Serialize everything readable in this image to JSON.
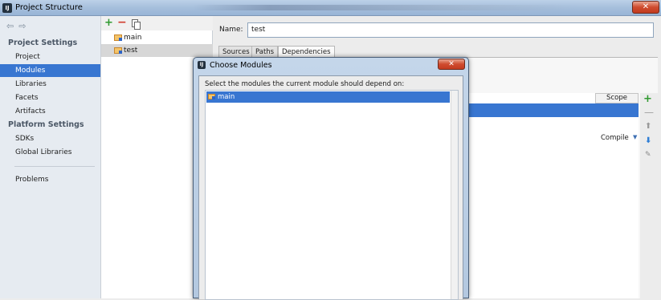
{
  "window": {
    "title": "Project Structure",
    "close_glyph": "✕"
  },
  "sidebar": {
    "nav_back": "⇦",
    "nav_forward": "⇨",
    "project_settings_header": "Project Settings",
    "project_items": [
      "Project",
      "Modules",
      "Libraries",
      "Facets",
      "Artifacts"
    ],
    "platform_settings_header": "Platform Settings",
    "platform_items": [
      "SDKs",
      "Global Libraries"
    ],
    "problems": "Problems",
    "selected": "Modules"
  },
  "tree": {
    "add": "+",
    "remove": "−",
    "modules": [
      "main",
      "test"
    ],
    "selected": "test"
  },
  "main": {
    "name_label": "Name:",
    "name_value": "test",
    "tabs": [
      "Sources",
      "Paths",
      "Dependencies"
    ],
    "active_tab": "Dependencies",
    "scope_header": "Scope",
    "scope_value": "Compile",
    "scope_arrow": "▼",
    "tools": {
      "add": "+",
      "remove": "—",
      "up": "⬆",
      "down": "⬇",
      "edit": "✎"
    }
  },
  "dialog": {
    "title": "Choose Modules",
    "close_glyph": "✕",
    "prompt": "Select the modules the current module should depend on:",
    "items": [
      "main"
    ],
    "selected": "main"
  },
  "colors": {
    "selection": "#3876d1",
    "add_green": "#2f9a2f",
    "remove_red": "#d03a2a"
  }
}
